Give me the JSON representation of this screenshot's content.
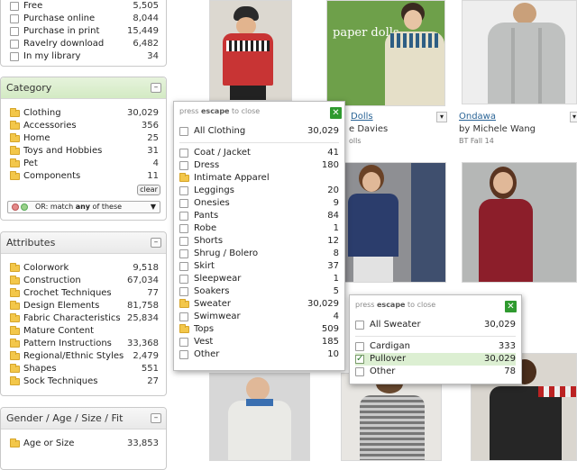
{
  "sidebar": {
    "availability": {
      "items": [
        {
          "label": "Free",
          "count": "5,505"
        },
        {
          "label": "Purchase online",
          "count": "8,044"
        },
        {
          "label": "Purchase in print",
          "count": "15,449"
        },
        {
          "label": "Ravelry download",
          "count": "6,482"
        },
        {
          "label": "In my library",
          "count": "34"
        }
      ]
    },
    "category": {
      "title": "Category",
      "items": [
        {
          "label": "Clothing",
          "count": "30,029"
        },
        {
          "label": "Accessories",
          "count": "356"
        },
        {
          "label": "Home",
          "count": "25"
        },
        {
          "label": "Toys and Hobbies",
          "count": "31"
        },
        {
          "label": "Pet",
          "count": "4"
        },
        {
          "label": "Components",
          "count": "11"
        }
      ],
      "clear_label": "clear",
      "match_text": "OR: match ",
      "match_bold": "any",
      "match_suffix": " of these"
    },
    "attributes": {
      "title": "Attributes",
      "items": [
        {
          "label": "Colorwork",
          "count": "9,518"
        },
        {
          "label": "Construction",
          "count": "67,034"
        },
        {
          "label": "Crochet Techniques",
          "count": "77"
        },
        {
          "label": "Design Elements",
          "count": "81,758"
        },
        {
          "label": "Fabric Characteristics",
          "count": "25,834"
        },
        {
          "label": "Mature Content",
          "count": ""
        },
        {
          "label": "Pattern Instructions",
          "count": "33,368"
        },
        {
          "label": "Regional/Ethnic Styles",
          "count": "2,479"
        },
        {
          "label": "Shapes",
          "count": "551"
        },
        {
          "label": "Sock Techniques",
          "count": "27"
        }
      ]
    },
    "gender": {
      "title": "Gender / Age / Size / Fit",
      "items": [
        {
          "label": "Age or Size",
          "count": "33,853"
        }
      ]
    },
    "minus_symbol": "–"
  },
  "grid": {
    "card2": {
      "title_overlay": "paper dolls",
      "name": "Dolls",
      "designer": "e Davies",
      "source": "olls"
    },
    "card3": {
      "name": "Ondawa",
      "designer": "by Michele Wang",
      "source": "BT Fall 14"
    },
    "dropdown_symbol": "▾"
  },
  "clothing_popup": {
    "hint_prefix": "press ",
    "hint_key": "escape",
    "hint_suffix": " to close",
    "close_symbol": "✕",
    "all": {
      "label": "All Clothing",
      "count": "30,029"
    },
    "items": [
      {
        "label": "Coat / Jacket",
        "count": "41",
        "type": "checkbox"
      },
      {
        "label": "Dress",
        "count": "180",
        "type": "checkbox"
      },
      {
        "label": "Intimate Apparel",
        "count": "",
        "type": "folder"
      },
      {
        "label": "Leggings",
        "count": "20",
        "type": "checkbox"
      },
      {
        "label": "Onesies",
        "count": "9",
        "type": "checkbox"
      },
      {
        "label": "Pants",
        "count": "84",
        "type": "checkbox"
      },
      {
        "label": "Robe",
        "count": "1",
        "type": "checkbox"
      },
      {
        "label": "Shorts",
        "count": "12",
        "type": "checkbox"
      },
      {
        "label": "Shrug / Bolero",
        "count": "8",
        "type": "checkbox"
      },
      {
        "label": "Skirt",
        "count": "37",
        "type": "checkbox"
      },
      {
        "label": "Sleepwear",
        "count": "1",
        "type": "checkbox"
      },
      {
        "label": "Soakers",
        "count": "5",
        "type": "checkbox"
      },
      {
        "label": "Sweater",
        "count": "30,029",
        "type": "folder"
      },
      {
        "label": "Swimwear",
        "count": "4",
        "type": "checkbox"
      },
      {
        "label": "Tops",
        "count": "509",
        "type": "folder"
      },
      {
        "label": "Vest",
        "count": "185",
        "type": "checkbox"
      },
      {
        "label": "Other",
        "count": "10",
        "type": "checkbox"
      }
    ]
  },
  "sweater_popup": {
    "hint_prefix": "press ",
    "hint_key": "escape",
    "hint_suffix": " to close",
    "close_symbol": "✕",
    "all": {
      "label": "All Sweater",
      "count": "30,029"
    },
    "items": [
      {
        "label": "Cardigan",
        "count": "333",
        "checked": false
      },
      {
        "label": "Pullover",
        "count": "30,029",
        "checked": true
      },
      {
        "label": "Other",
        "count": "78",
        "checked": false
      }
    ]
  },
  "colors": {
    "category_header": "#d3eac3",
    "selected_row": "#dcefd2",
    "close_green": "#2f9a2f",
    "link": "#2a6496",
    "folder": "#f3c74a"
  }
}
